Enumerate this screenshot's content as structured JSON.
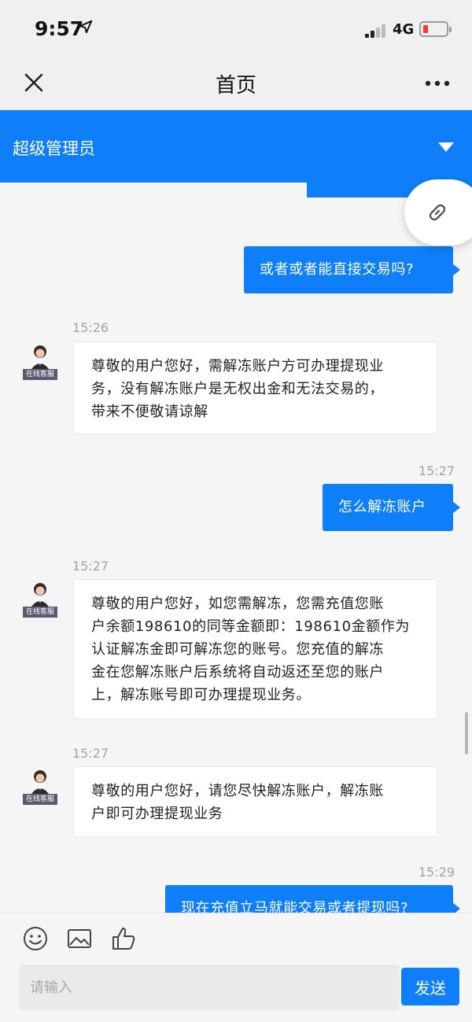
{
  "status": {
    "time": "9:57",
    "network": "4G",
    "battery_color": "#ff3b30"
  },
  "nav": {
    "title": "首页"
  },
  "role": {
    "label": "超级管理员"
  },
  "accent_color": "#0e7ff8",
  "messages": [
    {
      "direction": "out",
      "text": "或者或者能直接交易吗?"
    },
    {
      "direction": "in",
      "time": "15:26",
      "avatar_badge": "在线客服",
      "lines": [
        "尊敬的用户您好，需解冻账户方可办理提现业",
        "务，没有解冻账户是无权出金和无法交易的，",
        "带来不便敬请谅解"
      ]
    },
    {
      "direction": "out",
      "time": "15:27",
      "text": "怎么解冻账户"
    },
    {
      "direction": "in",
      "time": "15:27",
      "avatar_badge": "在线客服",
      "lines": [
        "尊敬的用户您好，如您需解冻，您需充值您账",
        "户余额198610的同等金额即：198610金额作为",
        "认证解冻金即可解冻您的账号。您充值的解冻",
        "金在您解冻账户后系统将自动返还至您的账户",
        "上，解冻账号即可办理提现业务。"
      ]
    },
    {
      "direction": "in",
      "time": "15:27",
      "avatar_badge": "在线客服",
      "lines": [
        "尊敬的用户您好，请您尽快解冻账户，解冻账",
        "户即可办理提现业务"
      ]
    },
    {
      "direction": "out",
      "time": "15:29",
      "text": "现在充值立马就能交易或者提现吗?"
    }
  ],
  "input": {
    "placeholder": "请输入",
    "value": ""
  },
  "send_label": "发送",
  "toolbar_icons": [
    "smiley-icon",
    "image-icon",
    "thumbs-up-icon"
  ]
}
